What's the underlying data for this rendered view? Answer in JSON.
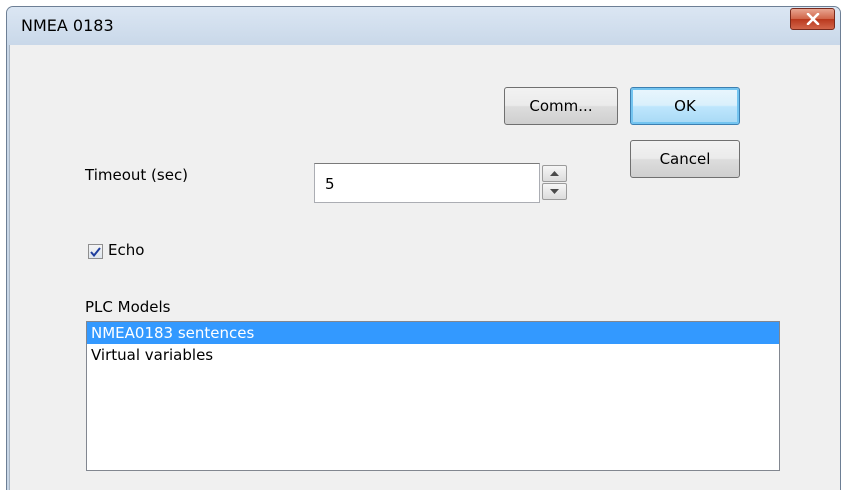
{
  "window": {
    "title": "NMEA 0183"
  },
  "buttons": {
    "comm_label": "Comm...",
    "ok_label": "OK",
    "cancel_label": "Cancel"
  },
  "timeout": {
    "label": "Timeout (sec)",
    "value": "5"
  },
  "echo": {
    "label": "Echo",
    "checked": true
  },
  "plc_models": {
    "label": "PLC Models",
    "items": [
      {
        "label": "NMEA0183 sentences",
        "selected": true
      },
      {
        "label": "Virtual variables",
        "selected": false
      }
    ]
  },
  "icons": {
    "close": "close-icon",
    "spin_up": "arrow-up-icon",
    "spin_down": "arrow-down-icon",
    "check": "checkmark-icon"
  },
  "colors": {
    "selection": "#3399ff",
    "close_button": "#c9452a",
    "titlebar": "#c9d7e7",
    "client_bg": "#f0f0f0"
  }
}
